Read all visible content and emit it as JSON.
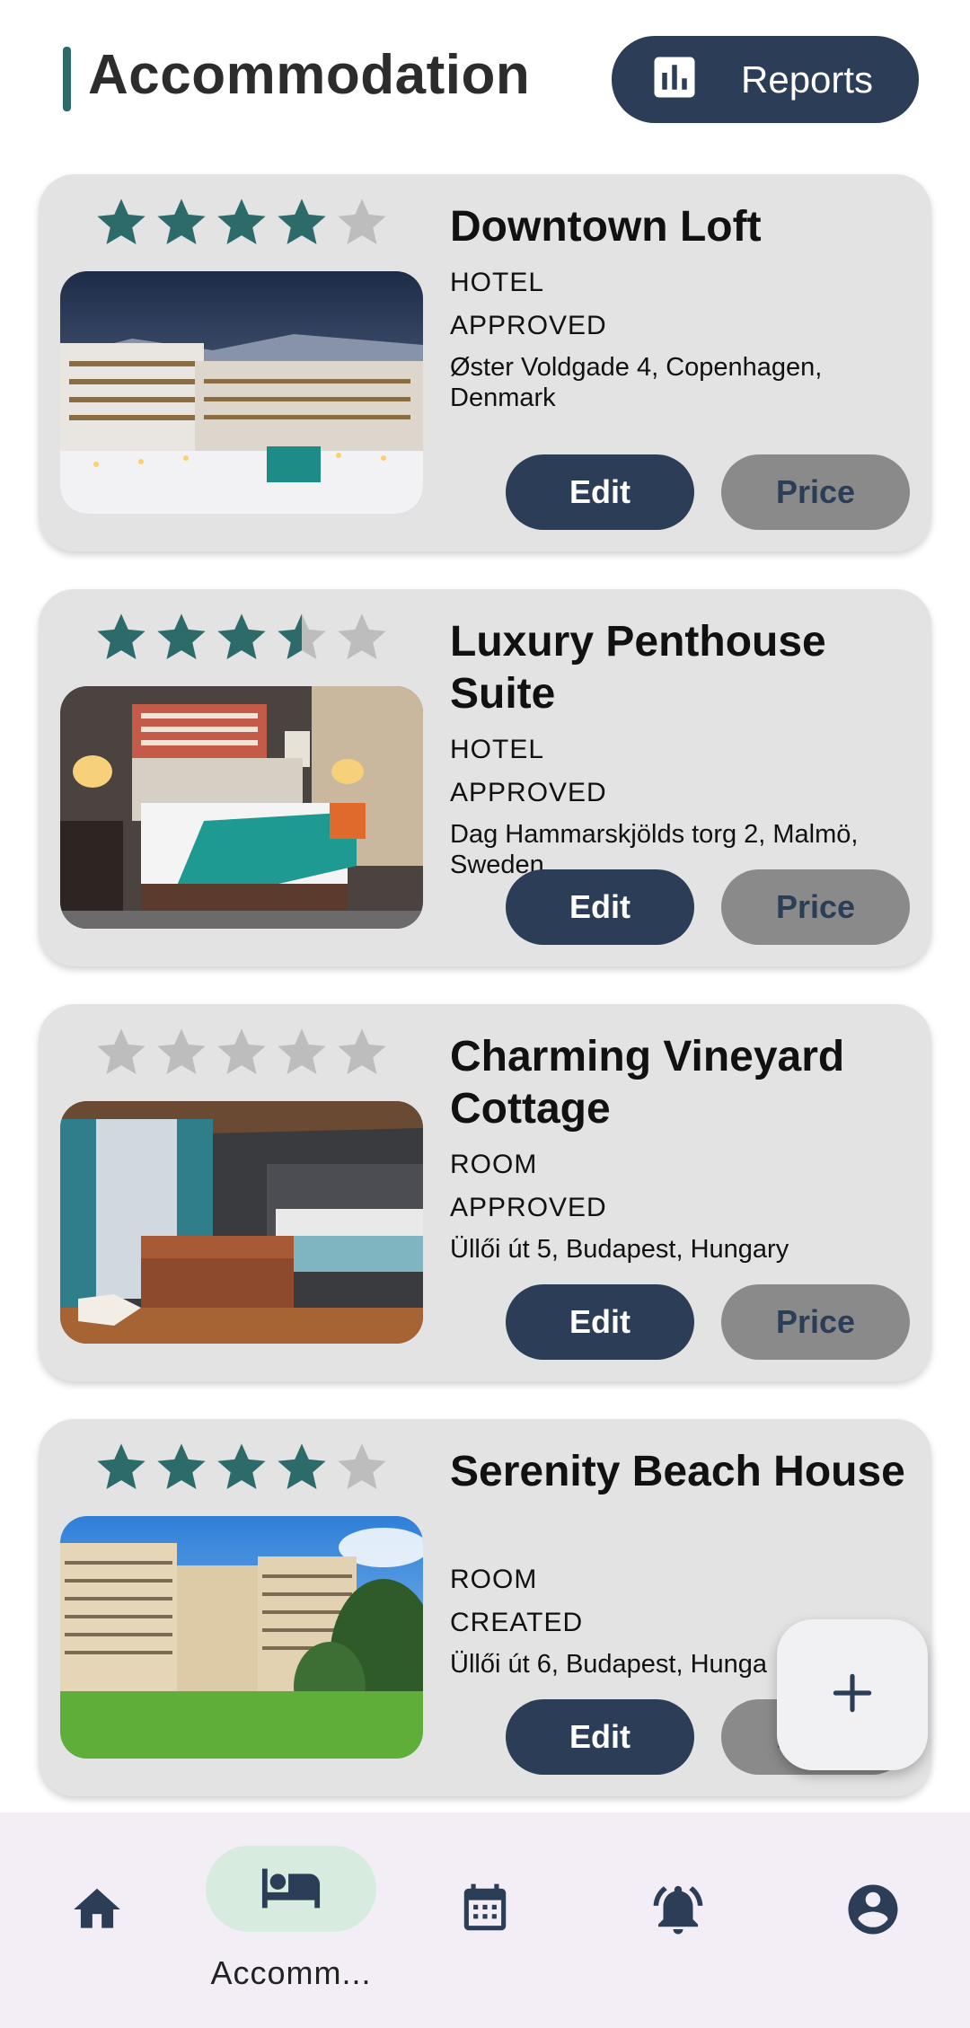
{
  "header": {
    "title": "Accommodation",
    "reports_label": "Reports",
    "reports_icon": "bar-chart-icon"
  },
  "colors": {
    "primary": "#2c3e57",
    "accent": "#2d6b6b",
    "star_filled": "#2d6b6b",
    "star_empty": "#bdbdbd",
    "card_bg": "#e3e3e3",
    "price_bg": "#8a8a8a",
    "nav_bg": "#f3eef6",
    "nav_active_pill": "#d7ecdf"
  },
  "listings": [
    {
      "name": "Downtown Loft",
      "type": "HOTEL",
      "status": "APPROVED",
      "address": "Øster Voldgade 4, Copenhagen, Denmark",
      "rating": 4,
      "edit_label": "Edit",
      "price_label": "Price"
    },
    {
      "name": "Luxury Penthouse Suite",
      "type": "HOTEL",
      "status": "APPROVED",
      "address": "Dag Hammarskjölds torg 2, Malmö, Sweden",
      "rating": 3.5,
      "edit_label": "Edit",
      "price_label": "Price"
    },
    {
      "name": "Charming Vineyard Cottage",
      "type": "ROOM",
      "status": "APPROVED",
      "address": "Üllői út 5,  Budapest, Hungary",
      "rating": 0,
      "edit_label": "Edit",
      "price_label": "Price"
    },
    {
      "name": "Serenity Beach House",
      "type": "ROOM",
      "status": "CREATED",
      "address": "Üllői út 6,  Budapest, Hunga",
      "rating": 4,
      "edit_label": "Edit",
      "price_label": "Price"
    }
  ],
  "fab": {
    "icon": "plus-icon"
  },
  "bottom_nav": {
    "items": [
      {
        "icon": "home-icon",
        "label": ""
      },
      {
        "icon": "bed-icon",
        "label": "Accomm...",
        "active": true
      },
      {
        "icon": "calendar-icon",
        "label": ""
      },
      {
        "icon": "notifications-icon",
        "label": ""
      },
      {
        "icon": "account-icon",
        "label": ""
      }
    ]
  }
}
